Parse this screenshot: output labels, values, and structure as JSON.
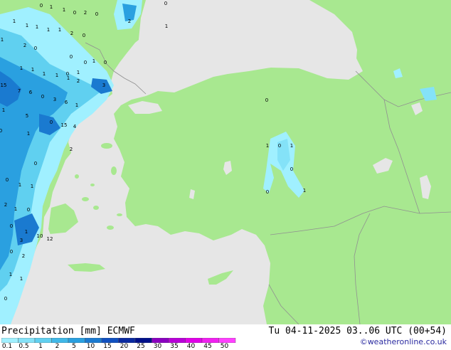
{
  "footer": {
    "title_left": "Precipitation [mm]",
    "model": "ECMWF",
    "datetime": "Tu 04-11-2025 03..06 UTC (00+54)",
    "credit": "©weatheronline.co.uk"
  },
  "legend": {
    "ticks": [
      "0.1",
      "0.5",
      "1",
      "2",
      "5",
      "10",
      "15",
      "20",
      "25",
      "30",
      "35",
      "40",
      "45",
      "50"
    ],
    "colors": [
      "#a0f0ff",
      "#84e2f8",
      "#60d0f0",
      "#40b8e8",
      "#2aa0e0",
      "#1a7ad0",
      "#1050c0",
      "#0a2aa0",
      "#00108a",
      "#8a00c0",
      "#b800d8",
      "#e000e8",
      "#f020f0",
      "#ff40ff"
    ]
  },
  "map": {
    "land_color": "#a8e890",
    "sea_color": "#e6e6e6",
    "precip_labels": [
      {
        "t": "0"
      },
      {
        "t": "1"
      },
      {
        "t": "1"
      },
      {
        "t": "0"
      },
      {
        "t": "2"
      },
      {
        "t": "0"
      },
      {
        "t": "2"
      },
      {
        "t": "0"
      },
      {
        "t": "1"
      },
      {
        "t": "1"
      },
      {
        "t": "1"
      },
      {
        "t": "1"
      },
      {
        "t": "1"
      },
      {
        "t": "2"
      },
      {
        "t": "0"
      },
      {
        "t": "0"
      },
      {
        "t": "1"
      },
      {
        "t": "2"
      },
      {
        "t": "0"
      },
      {
        "t": "0"
      },
      {
        "t": "1"
      },
      {
        "t": "0"
      },
      {
        "t": "1"
      },
      {
        "t": "1"
      },
      {
        "t": "1"
      },
      {
        "t": "1"
      },
      {
        "t": "0"
      },
      {
        "t": "1"
      },
      {
        "t": "1"
      },
      {
        "t": "2"
      },
      {
        "t": "3"
      },
      {
        "t": "15"
      },
      {
        "t": "7"
      },
      {
        "t": "6"
      },
      {
        "t": "0"
      },
      {
        "t": "3"
      },
      {
        "t": "6"
      },
      {
        "t": "1"
      },
      {
        "t": "1"
      },
      {
        "t": "5"
      },
      {
        "t": "0"
      },
      {
        "t": "15"
      },
      {
        "t": "4"
      },
      {
        "t": "2"
      },
      {
        "t": "1"
      },
      {
        "t": "0"
      },
      {
        "t": "1"
      },
      {
        "t": "0"
      },
      {
        "t": "1"
      },
      {
        "t": "2"
      },
      {
        "t": "1"
      },
      {
        "t": "0"
      },
      {
        "t": "1"
      },
      {
        "t": "10"
      },
      {
        "t": "12"
      },
      {
        "t": "3"
      },
      {
        "t": "0"
      },
      {
        "t": "2"
      },
      {
        "t": "1"
      },
      {
        "t": "1"
      },
      {
        "t": "0"
      },
      {
        "t": "1"
      },
      {
        "t": "0"
      },
      {
        "t": "1"
      },
      {
        "t": "0"
      },
      {
        "t": "0"
      },
      {
        "t": "1"
      },
      {
        "t": "0"
      },
      {
        "t": "1"
      },
      {
        "t": "0"
      },
      {
        "t": "0"
      }
    ]
  }
}
